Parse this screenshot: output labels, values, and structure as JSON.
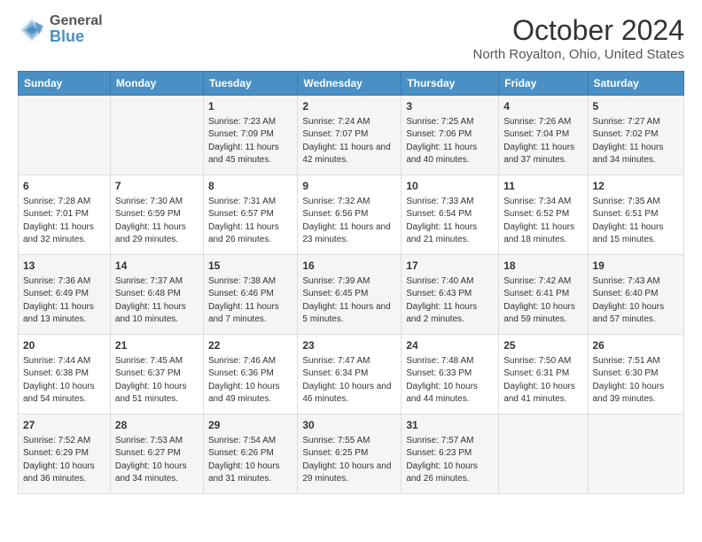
{
  "logo": {
    "general": "General",
    "blue": "Blue"
  },
  "header": {
    "title": "October 2024",
    "subtitle": "North Royalton, Ohio, United States"
  },
  "days_of_week": [
    "Sunday",
    "Monday",
    "Tuesday",
    "Wednesday",
    "Thursday",
    "Friday",
    "Saturday"
  ],
  "weeks": [
    [
      {
        "day": "",
        "info": ""
      },
      {
        "day": "",
        "info": ""
      },
      {
        "day": "1",
        "info": "Sunrise: 7:23 AM\nSunset: 7:09 PM\nDaylight: 11 hours and 45 minutes."
      },
      {
        "day": "2",
        "info": "Sunrise: 7:24 AM\nSunset: 7:07 PM\nDaylight: 11 hours and 42 minutes."
      },
      {
        "day": "3",
        "info": "Sunrise: 7:25 AM\nSunset: 7:06 PM\nDaylight: 11 hours and 40 minutes."
      },
      {
        "day": "4",
        "info": "Sunrise: 7:26 AM\nSunset: 7:04 PM\nDaylight: 11 hours and 37 minutes."
      },
      {
        "day": "5",
        "info": "Sunrise: 7:27 AM\nSunset: 7:02 PM\nDaylight: 11 hours and 34 minutes."
      }
    ],
    [
      {
        "day": "6",
        "info": "Sunrise: 7:28 AM\nSunset: 7:01 PM\nDaylight: 11 hours and 32 minutes."
      },
      {
        "day": "7",
        "info": "Sunrise: 7:30 AM\nSunset: 6:59 PM\nDaylight: 11 hours and 29 minutes."
      },
      {
        "day": "8",
        "info": "Sunrise: 7:31 AM\nSunset: 6:57 PM\nDaylight: 11 hours and 26 minutes."
      },
      {
        "day": "9",
        "info": "Sunrise: 7:32 AM\nSunset: 6:56 PM\nDaylight: 11 hours and 23 minutes."
      },
      {
        "day": "10",
        "info": "Sunrise: 7:33 AM\nSunset: 6:54 PM\nDaylight: 11 hours and 21 minutes."
      },
      {
        "day": "11",
        "info": "Sunrise: 7:34 AM\nSunset: 6:52 PM\nDaylight: 11 hours and 18 minutes."
      },
      {
        "day": "12",
        "info": "Sunrise: 7:35 AM\nSunset: 6:51 PM\nDaylight: 11 hours and 15 minutes."
      }
    ],
    [
      {
        "day": "13",
        "info": "Sunrise: 7:36 AM\nSunset: 6:49 PM\nDaylight: 11 hours and 13 minutes."
      },
      {
        "day": "14",
        "info": "Sunrise: 7:37 AM\nSunset: 6:48 PM\nDaylight: 11 hours and 10 minutes."
      },
      {
        "day": "15",
        "info": "Sunrise: 7:38 AM\nSunset: 6:46 PM\nDaylight: 11 hours and 7 minutes."
      },
      {
        "day": "16",
        "info": "Sunrise: 7:39 AM\nSunset: 6:45 PM\nDaylight: 11 hours and 5 minutes."
      },
      {
        "day": "17",
        "info": "Sunrise: 7:40 AM\nSunset: 6:43 PM\nDaylight: 11 hours and 2 minutes."
      },
      {
        "day": "18",
        "info": "Sunrise: 7:42 AM\nSunset: 6:41 PM\nDaylight: 10 hours and 59 minutes."
      },
      {
        "day": "19",
        "info": "Sunrise: 7:43 AM\nSunset: 6:40 PM\nDaylight: 10 hours and 57 minutes."
      }
    ],
    [
      {
        "day": "20",
        "info": "Sunrise: 7:44 AM\nSunset: 6:38 PM\nDaylight: 10 hours and 54 minutes."
      },
      {
        "day": "21",
        "info": "Sunrise: 7:45 AM\nSunset: 6:37 PM\nDaylight: 10 hours and 51 minutes."
      },
      {
        "day": "22",
        "info": "Sunrise: 7:46 AM\nSunset: 6:36 PM\nDaylight: 10 hours and 49 minutes."
      },
      {
        "day": "23",
        "info": "Sunrise: 7:47 AM\nSunset: 6:34 PM\nDaylight: 10 hours and 46 minutes."
      },
      {
        "day": "24",
        "info": "Sunrise: 7:48 AM\nSunset: 6:33 PM\nDaylight: 10 hours and 44 minutes."
      },
      {
        "day": "25",
        "info": "Sunrise: 7:50 AM\nSunset: 6:31 PM\nDaylight: 10 hours and 41 minutes."
      },
      {
        "day": "26",
        "info": "Sunrise: 7:51 AM\nSunset: 6:30 PM\nDaylight: 10 hours and 39 minutes."
      }
    ],
    [
      {
        "day": "27",
        "info": "Sunrise: 7:52 AM\nSunset: 6:29 PM\nDaylight: 10 hours and 36 minutes."
      },
      {
        "day": "28",
        "info": "Sunrise: 7:53 AM\nSunset: 6:27 PM\nDaylight: 10 hours and 34 minutes."
      },
      {
        "day": "29",
        "info": "Sunrise: 7:54 AM\nSunset: 6:26 PM\nDaylight: 10 hours and 31 minutes."
      },
      {
        "day": "30",
        "info": "Sunrise: 7:55 AM\nSunset: 6:25 PM\nDaylight: 10 hours and 29 minutes."
      },
      {
        "day": "31",
        "info": "Sunrise: 7:57 AM\nSunset: 6:23 PM\nDaylight: 10 hours and 26 minutes."
      },
      {
        "day": "",
        "info": ""
      },
      {
        "day": "",
        "info": ""
      }
    ]
  ]
}
